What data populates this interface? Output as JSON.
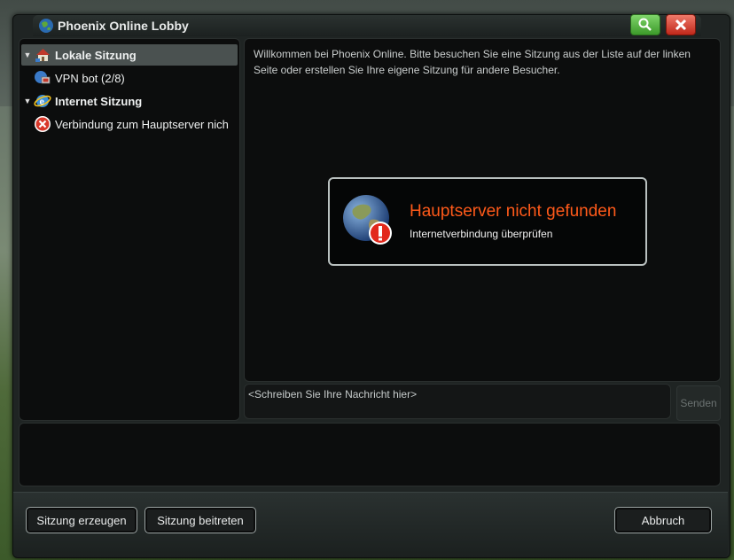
{
  "window": {
    "title": "Phoenix Online Lobby"
  },
  "tree": {
    "items": [
      {
        "label": "Lokale Sitzung",
        "icon": "house-network-icon",
        "expanded": true
      },
      {
        "label": "VPN bot (2/8)",
        "icon": "network-computer-icon"
      },
      {
        "label": "Internet Sitzung",
        "icon": "internet-explorer-globe-icon",
        "expanded": true
      },
      {
        "label": "Verbindung zum Hauptserver nich",
        "icon": "error-x-icon"
      }
    ]
  },
  "chat": {
    "welcome": "Willkommen bei Phoenix Online. Bitte besuchen Sie eine Sitzung aus der Liste auf der linken Seite oder erstellen Sie Ihre eigene Sitzung für andere Besucher.",
    "input_placeholder": "<Schreiben Sie Ihre Nachricht hier>",
    "send_label": "Senden"
  },
  "alert": {
    "title": "Hauptserver nicht gefunden",
    "subtitle": "Internetverbindung überprüfen",
    "title_color": "#ff5a1a"
  },
  "footer": {
    "create_label": "Sitzung erzeugen",
    "join_label": "Sitzung beitreten",
    "cancel_label": "Abbruch"
  },
  "colors": {
    "accent_search": "#4caf36",
    "accent_close": "#d8382a"
  }
}
